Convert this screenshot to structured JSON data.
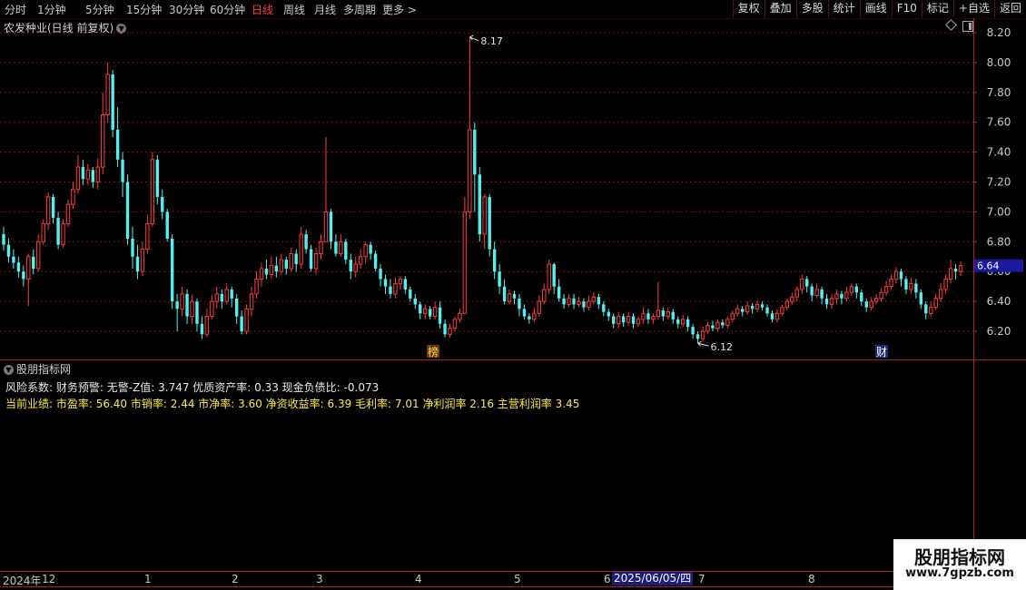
{
  "toolbar": {
    "periods": [
      "分时",
      "1分钟",
      "5分钟",
      "15分钟",
      "30分钟",
      "60分钟",
      "日线",
      "周线",
      "月线",
      "多周期",
      "更多 >"
    ],
    "active_period": "日线",
    "tools": [
      "复权",
      "叠加",
      "多股",
      "统计",
      "画线",
      "F10",
      "标记",
      "+自选",
      "返回"
    ]
  },
  "stock": {
    "title": "农发种业(日线 前复权)"
  },
  "price_axis": {
    "ticks": [
      "8.20",
      "8.00",
      "7.80",
      "7.60",
      "7.40",
      "7.20",
      "7.00",
      "6.80",
      "6.60",
      "6.40",
      "6.20"
    ],
    "current_price": "6.64"
  },
  "annotations": {
    "high_label": "8.17",
    "low_label": "6.12",
    "marker_bang": "榜",
    "marker_cai": "财"
  },
  "indicator": {
    "name": "股朋指标网",
    "risk_line": "风险系数: 财务预警: 无警-Z值: 3.747 优质资产率: 0.33 现金负债比: -0.073",
    "perf_line": "当前业绩: 市盈率: 56.40 市销率: 2.44 市净率: 3.60 净资收益率: 6.39 毛利率: 7.01 净利润率 2.16 主营利润率 3.45"
  },
  "date_axis": {
    "labels": [
      "2024年",
      "12",
      "1",
      "2",
      "3",
      "4",
      "5",
      "6",
      "7",
      "8"
    ],
    "cursor_date": "2025/06/05/四"
  },
  "watermark": {
    "title": "股朋指标网",
    "url": "www.7gpzb.com"
  },
  "colors": {
    "up": "#ff3c3c",
    "down": "#54f0f0",
    "grid": "#8a1010",
    "yellow": "#ffe94a"
  },
  "chart_data": {
    "type": "candlestick",
    "title": "农发种业(日线 前复权)",
    "ylim": [
      6.1,
      8.25
    ],
    "candles": [
      [
        6.85,
        6.78,
        6.9,
        6.74
      ],
      [
        6.78,
        6.7,
        6.82,
        6.66
      ],
      [
        6.7,
        6.66,
        6.75,
        6.62
      ],
      [
        6.66,
        6.6,
        6.7,
        6.56
      ],
      [
        6.6,
        6.55,
        6.64,
        6.5
      ],
      [
        6.55,
        6.7,
        6.72,
        6.37
      ],
      [
        6.7,
        6.62,
        6.75,
        6.58
      ],
      [
        6.62,
        6.8,
        6.85,
        6.6
      ],
      [
        6.8,
        6.92,
        6.95,
        6.78
      ],
      [
        6.92,
        7.1,
        7.13,
        6.88
      ],
      [
        7.1,
        6.96,
        7.12,
        6.92
      ],
      [
        6.96,
        6.78,
        7.0,
        6.75
      ],
      [
        6.78,
        6.92,
        6.95,
        6.76
      ],
      [
        6.92,
        7.05,
        7.08,
        6.9
      ],
      [
        7.05,
        7.15,
        7.2,
        7.02
      ],
      [
        7.15,
        7.3,
        7.38,
        7.12
      ],
      [
        7.3,
        7.22,
        7.35,
        7.18
      ],
      [
        7.22,
        7.28,
        7.32,
        7.18
      ],
      [
        7.28,
        7.2,
        7.3,
        7.16
      ],
      [
        7.2,
        7.3,
        7.36,
        7.15
      ],
      [
        7.3,
        7.65,
        7.8,
        7.25
      ],
      [
        7.65,
        7.92,
        8.0,
        7.6
      ],
      [
        7.92,
        7.55,
        7.95,
        7.5
      ],
      [
        7.55,
        7.35,
        7.7,
        7.3
      ],
      [
        7.35,
        7.2,
        7.4,
        7.1
      ],
      [
        7.2,
        6.82,
        7.25,
        6.78
      ],
      [
        6.82,
        6.7,
        6.9,
        6.62
      ],
      [
        6.7,
        6.6,
        6.78,
        6.55
      ],
      [
        6.6,
        6.75,
        6.8,
        6.57
      ],
      [
        6.75,
        6.92,
        6.98,
        6.72
      ],
      [
        6.92,
        7.35,
        7.4,
        6.9
      ],
      [
        7.35,
        7.1,
        7.38,
        7.05
      ],
      [
        7.1,
        7.0,
        7.15,
        6.95
      ],
      [
        7.0,
        6.82,
        7.02,
        6.8
      ],
      [
        6.82,
        6.4,
        6.85,
        6.35
      ],
      [
        6.4,
        6.35,
        6.45,
        6.2
      ],
      [
        6.35,
        6.45,
        6.5,
        6.3
      ],
      [
        6.45,
        6.3,
        6.48,
        6.25
      ],
      [
        6.3,
        6.4,
        6.44,
        6.25
      ],
      [
        6.4,
        6.25,
        6.42,
        6.2
      ],
      [
        6.25,
        6.18,
        6.3,
        6.15
      ],
      [
        6.18,
        6.3,
        6.35,
        6.16
      ],
      [
        6.3,
        6.4,
        6.44,
        6.28
      ],
      [
        6.4,
        6.45,
        6.5,
        6.35
      ],
      [
        6.45,
        6.4,
        6.48,
        6.35
      ],
      [
        6.4,
        6.48,
        6.52,
        6.38
      ],
      [
        6.48,
        6.42,
        6.5,
        6.36
      ],
      [
        6.42,
        6.3,
        6.45,
        6.25
      ],
      [
        6.3,
        6.2,
        6.34,
        6.18
      ],
      [
        6.2,
        6.35,
        6.38,
        6.18
      ],
      [
        6.35,
        6.45,
        6.5,
        6.3
      ],
      [
        6.45,
        6.55,
        6.6,
        6.42
      ],
      [
        6.55,
        6.62,
        6.66,
        6.5
      ],
      [
        6.62,
        6.58,
        6.68,
        6.55
      ],
      [
        6.58,
        6.64,
        6.7,
        6.55
      ],
      [
        6.64,
        6.6,
        6.7,
        6.56
      ],
      [
        6.6,
        6.68,
        6.72,
        6.58
      ],
      [
        6.68,
        6.62,
        6.7,
        6.58
      ],
      [
        6.62,
        6.72,
        6.76,
        6.6
      ],
      [
        6.72,
        6.65,
        6.75,
        6.6
      ],
      [
        6.65,
        6.85,
        6.9,
        6.62
      ],
      [
        6.85,
        6.75,
        6.88,
        6.72
      ],
      [
        6.75,
        6.62,
        6.78,
        6.6
      ],
      [
        6.62,
        6.72,
        6.76,
        6.58
      ],
      [
        6.72,
        6.8,
        6.85,
        6.68
      ],
      [
        6.8,
        7.0,
        7.5,
        6.95
      ],
      [
        7.0,
        6.8,
        7.02,
        6.75
      ],
      [
        6.8,
        6.72,
        6.85,
        6.7
      ],
      [
        6.72,
        6.8,
        6.85,
        6.7
      ],
      [
        6.8,
        6.68,
        6.82,
        6.65
      ],
      [
        6.68,
        6.6,
        6.72,
        6.55
      ],
      [
        6.6,
        6.65,
        6.7,
        6.56
      ],
      [
        6.65,
        6.7,
        6.75,
        6.62
      ],
      [
        6.7,
        6.78,
        6.8,
        6.65
      ],
      [
        6.78,
        6.72,
        6.8,
        6.68
      ],
      [
        6.72,
        6.62,
        6.74,
        6.6
      ],
      [
        6.62,
        6.55,
        6.65,
        6.5
      ],
      [
        6.55,
        6.5,
        6.58,
        6.45
      ],
      [
        6.5,
        6.45,
        6.55,
        6.42
      ],
      [
        6.45,
        6.52,
        6.56,
        6.42
      ],
      [
        6.52,
        6.55,
        6.57,
        6.48
      ],
      [
        6.55,
        6.48,
        6.57,
        6.45
      ],
      [
        6.48,
        6.42,
        6.5,
        6.4
      ],
      [
        6.42,
        6.38,
        6.45,
        6.35
      ],
      [
        6.38,
        6.32,
        6.4,
        6.28
      ],
      [
        6.32,
        6.35,
        6.38,
        6.28
      ],
      [
        6.35,
        6.3,
        6.37,
        6.28
      ],
      [
        6.3,
        6.36,
        6.4,
        6.28
      ],
      [
        6.36,
        6.25,
        6.4,
        6.22
      ],
      [
        6.25,
        6.18,
        6.28,
        6.16
      ],
      [
        6.18,
        6.22,
        6.25,
        6.16
      ],
      [
        6.22,
        6.28,
        6.3,
        6.2
      ],
      [
        6.28,
        6.32,
        6.35,
        6.26
      ],
      [
        6.32,
        7.0,
        7.1,
        6.42
      ],
      [
        7.0,
        7.55,
        8.17,
        6.95
      ],
      [
        7.55,
        7.25,
        7.6,
        7.0
      ],
      [
        7.25,
        6.85,
        7.3,
        6.8
      ],
      [
        6.85,
        7.1,
        7.12,
        6.75
      ],
      [
        7.1,
        6.75,
        7.12,
        6.7
      ],
      [
        6.75,
        6.6,
        6.8,
        6.55
      ],
      [
        6.6,
        6.5,
        6.65,
        6.45
      ],
      [
        6.5,
        6.4,
        6.55,
        6.38
      ],
      [
        6.4,
        6.45,
        6.48,
        6.38
      ],
      [
        6.45,
        6.42,
        6.47,
        6.38
      ],
      [
        6.42,
        6.35,
        6.45,
        6.3
      ],
      [
        6.35,
        6.3,
        6.38,
        6.28
      ],
      [
        6.3,
        6.28,
        6.32,
        6.25
      ],
      [
        6.28,
        6.32,
        6.36,
        6.26
      ],
      [
        6.32,
        6.4,
        6.44,
        6.3
      ],
      [
        6.4,
        6.48,
        6.52,
        6.38
      ],
      [
        6.48,
        6.65,
        6.68,
        6.45
      ],
      [
        6.65,
        6.5,
        6.66,
        6.45
      ],
      [
        6.5,
        6.42,
        6.55,
        6.4
      ],
      [
        6.42,
        6.38,
        6.45,
        6.35
      ],
      [
        6.38,
        6.42,
        6.45,
        6.36
      ],
      [
        6.42,
        6.38,
        6.45,
        6.35
      ],
      [
        6.38,
        6.4,
        6.43,
        6.36
      ],
      [
        6.4,
        6.36,
        6.42,
        6.33
      ],
      [
        6.36,
        6.4,
        6.44,
        6.34
      ],
      [
        6.4,
        6.43,
        6.46,
        6.38
      ],
      [
        6.43,
        6.38,
        6.45,
        6.35
      ],
      [
        6.38,
        6.33,
        6.4,
        6.3
      ],
      [
        6.33,
        6.3,
        6.35,
        6.27
      ],
      [
        6.3,
        6.25,
        6.32,
        6.22
      ],
      [
        6.25,
        6.3,
        6.33,
        6.22
      ],
      [
        6.3,
        6.26,
        6.32,
        6.23
      ],
      [
        6.26,
        6.3,
        6.33,
        6.24
      ],
      [
        6.3,
        6.25,
        6.32,
        6.22
      ],
      [
        6.25,
        6.28,
        6.3,
        6.23
      ],
      [
        6.28,
        6.32,
        6.36,
        6.25
      ],
      [
        6.32,
        6.28,
        6.35,
        6.25
      ],
      [
        6.28,
        6.3,
        6.32,
        6.25
      ],
      [
        6.3,
        6.34,
        6.53,
        6.28
      ],
      [
        6.34,
        6.3,
        6.36,
        6.27
      ],
      [
        6.3,
        6.33,
        6.36,
        6.28
      ],
      [
        6.33,
        6.28,
        6.35,
        6.25
      ],
      [
        6.28,
        6.25,
        6.3,
        6.22
      ],
      [
        6.25,
        6.28,
        6.31,
        6.23
      ],
      [
        6.28,
        6.23,
        6.3,
        6.2
      ],
      [
        6.23,
        6.18,
        6.25,
        6.15
      ],
      [
        6.18,
        6.15,
        6.2,
        6.12
      ],
      [
        6.15,
        6.2,
        6.23,
        6.13
      ],
      [
        6.2,
        6.24,
        6.26,
        6.18
      ],
      [
        6.24,
        6.22,
        6.27,
        6.2
      ],
      [
        6.22,
        6.26,
        6.28,
        6.2
      ],
      [
        6.26,
        6.24,
        6.28,
        6.22
      ],
      [
        6.24,
        6.28,
        6.3,
        6.22
      ],
      [
        6.28,
        6.32,
        6.34,
        6.26
      ],
      [
        6.32,
        6.35,
        6.38,
        6.3
      ],
      [
        6.35,
        6.33,
        6.37,
        6.3
      ],
      [
        6.33,
        6.37,
        6.4,
        6.31
      ],
      [
        6.37,
        6.35,
        6.39,
        6.32
      ],
      [
        6.35,
        6.38,
        6.41,
        6.33
      ],
      [
        6.38,
        6.36,
        6.4,
        6.34
      ],
      [
        6.36,
        6.32,
        6.38,
        6.3
      ],
      [
        6.32,
        6.28,
        6.34,
        6.26
      ],
      [
        6.28,
        6.32,
        6.35,
        6.26
      ],
      [
        6.32,
        6.36,
        6.38,
        6.3
      ],
      [
        6.36,
        6.4,
        6.42,
        6.34
      ],
      [
        6.4,
        6.43,
        6.46,
        6.38
      ],
      [
        6.43,
        6.48,
        6.5,
        6.4
      ],
      [
        6.48,
        6.55,
        6.58,
        6.45
      ],
      [
        6.55,
        6.5,
        6.57,
        6.46
      ],
      [
        6.5,
        6.44,
        6.52,
        6.4
      ],
      [
        6.44,
        6.48,
        6.52,
        6.42
      ],
      [
        6.48,
        6.42,
        6.5,
        6.38
      ],
      [
        6.42,
        6.38,
        6.45,
        6.35
      ],
      [
        6.38,
        6.42,
        6.45,
        6.35
      ],
      [
        6.42,
        6.45,
        6.48,
        6.38
      ],
      [
        6.45,
        6.42,
        6.47,
        6.38
      ],
      [
        6.42,
        6.46,
        6.5,
        6.4
      ],
      [
        6.46,
        6.5,
        6.52,
        6.44
      ],
      [
        6.5,
        6.46,
        6.52,
        6.42
      ],
      [
        6.46,
        6.4,
        6.48,
        6.37
      ],
      [
        6.4,
        6.36,
        6.42,
        6.33
      ],
      [
        6.36,
        6.4,
        6.43,
        6.34
      ],
      [
        6.4,
        6.42,
        6.45,
        6.38
      ],
      [
        6.42,
        6.46,
        6.49,
        6.4
      ],
      [
        6.46,
        6.5,
        6.54,
        6.44
      ],
      [
        6.5,
        6.55,
        6.58,
        6.48
      ],
      [
        6.55,
        6.6,
        6.63,
        6.52
      ],
      [
        6.6,
        6.55,
        6.62,
        6.5
      ],
      [
        6.55,
        6.48,
        6.57,
        6.45
      ],
      [
        6.48,
        6.52,
        6.56,
        6.45
      ],
      [
        6.52,
        6.46,
        6.55,
        6.42
      ],
      [
        6.46,
        6.38,
        6.48,
        6.35
      ],
      [
        6.38,
        6.32,
        6.4,
        6.28
      ],
      [
        6.32,
        6.36,
        6.4,
        6.3
      ],
      [
        6.36,
        6.42,
        6.45,
        6.34
      ],
      [
        6.42,
        6.48,
        6.52,
        6.4
      ],
      [
        6.48,
        6.55,
        6.58,
        6.45
      ],
      [
        6.55,
        6.62,
        6.68,
        6.52
      ],
      [
        6.62,
        6.6,
        6.65,
        6.55
      ],
      [
        6.6,
        6.64,
        6.67,
        6.57
      ]
    ]
  }
}
